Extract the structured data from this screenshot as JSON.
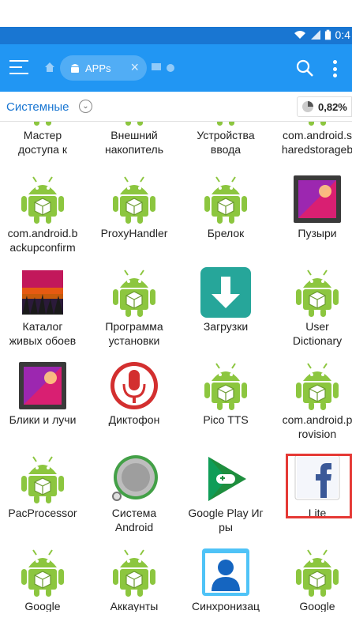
{
  "status_bar": {
    "time": "0:4",
    "bg": "#1976d2"
  },
  "app_bar": {
    "bg": "#2196f3",
    "tab_label": "APPs",
    "icons": [
      "menu-icon",
      "home-icon",
      "android-icon",
      "close-icon",
      "search-icon",
      "more-icon"
    ]
  },
  "path_bar": {
    "section": "Системные",
    "storage_percent": "0,82%"
  },
  "apps": [
    {
      "name": "Мастер\nдоступа к",
      "icon": "android"
    },
    {
      "name": "Внешний\nнакопитель",
      "icon": "android"
    },
    {
      "name": "Устройства\nввода",
      "icon": "android"
    },
    {
      "name": "com.android.s\nharedstorageb",
      "icon": "android"
    },
    {
      "name": "com.android.b\nackupconfirm",
      "icon": "android"
    },
    {
      "name": "ProxyHandler",
      "icon": "android"
    },
    {
      "name": "Брелок",
      "icon": "android"
    },
    {
      "name": "Пузыри",
      "icon": "gallery"
    },
    {
      "name": "Каталог\nживых обоев",
      "icon": "wallpaper"
    },
    {
      "name": "Программа\nустановки",
      "icon": "android"
    },
    {
      "name": "Загрузки",
      "icon": "download"
    },
    {
      "name": "User\nDictionary",
      "icon": "android"
    },
    {
      "name": "Блики и лучи",
      "icon": "gallery"
    },
    {
      "name": "Диктофон",
      "icon": "mic"
    },
    {
      "name": "Pico TTS",
      "icon": "android"
    },
    {
      "name": "com.android.p\nrovision",
      "icon": "android"
    },
    {
      "name": "PacProcessor",
      "icon": "android"
    },
    {
      "name": "Система\nAndroid",
      "icon": "system"
    },
    {
      "name": "Google Play Иг\nры",
      "icon": "playgames"
    },
    {
      "name": "Lite",
      "icon": "facebook"
    },
    {
      "name": "Google",
      "icon": "android"
    },
    {
      "name": "Аккаунты",
      "icon": "android"
    },
    {
      "name": "Синхронизац",
      "icon": "contacts"
    },
    {
      "name": "Google",
      "icon": "android"
    }
  ]
}
